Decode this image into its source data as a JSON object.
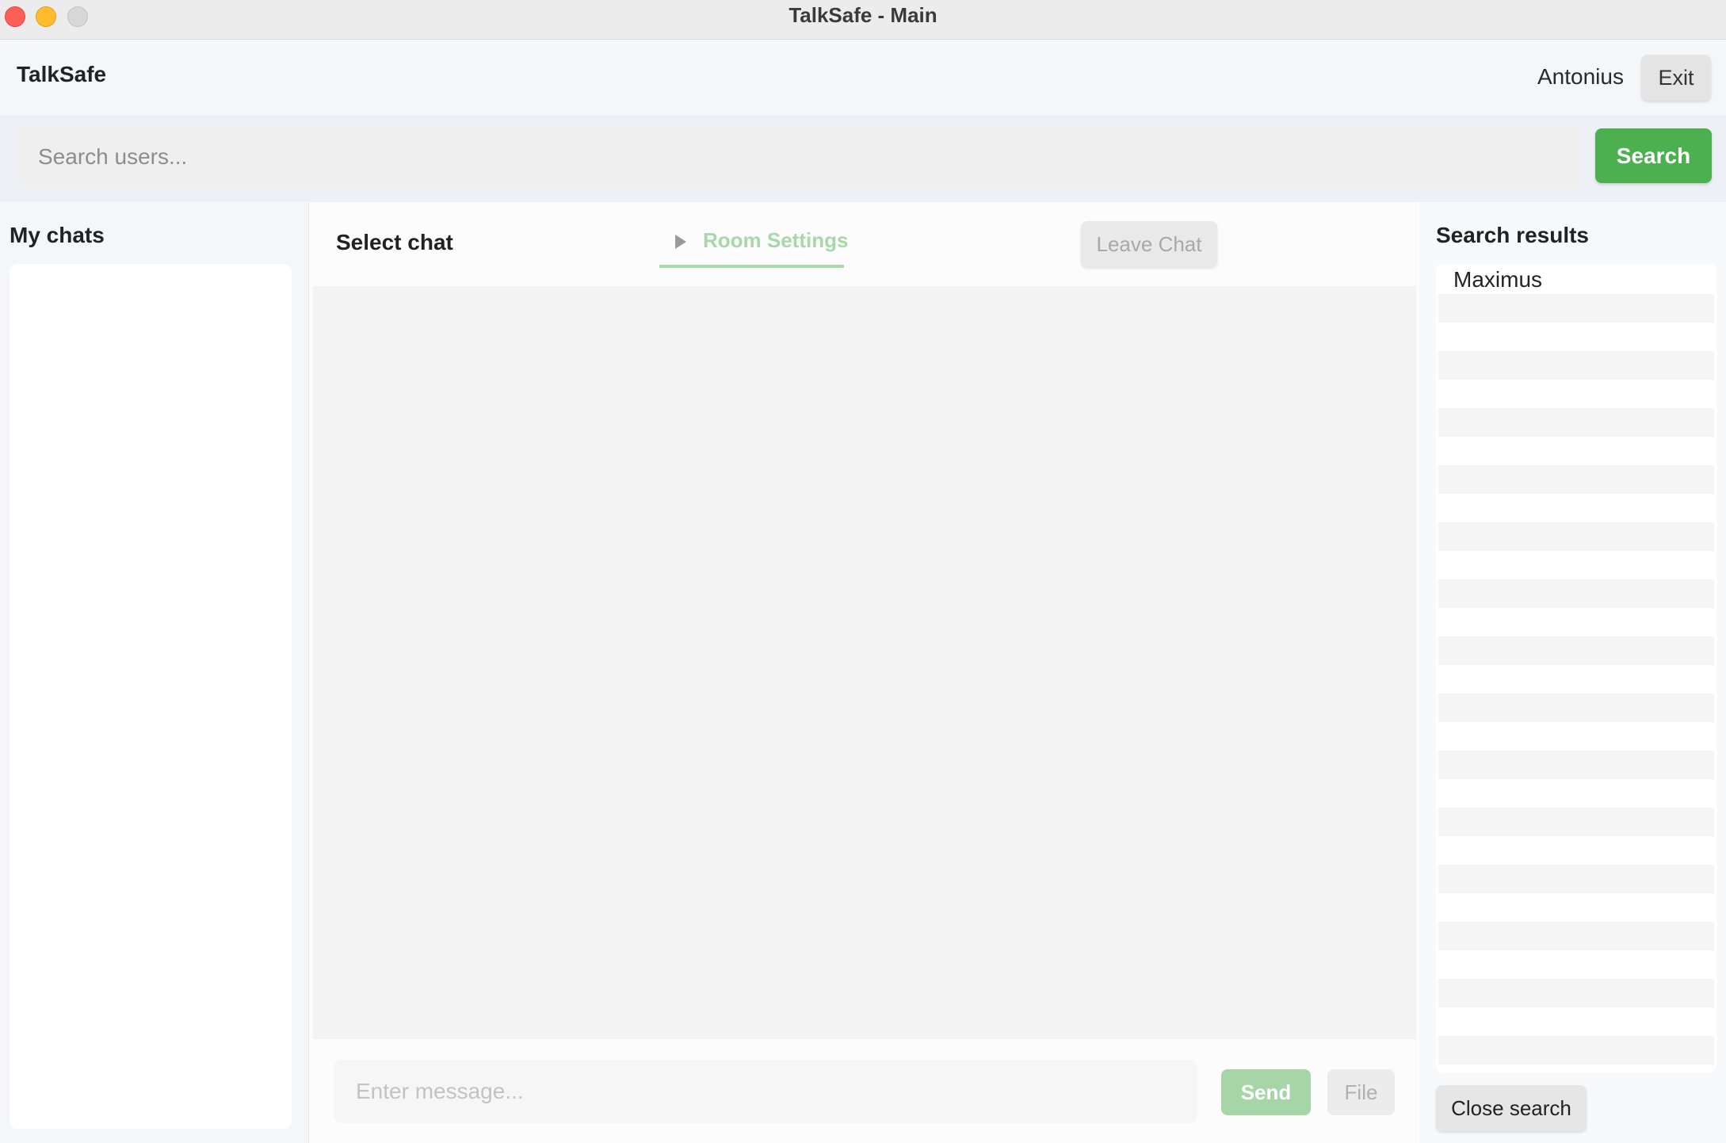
{
  "window": {
    "title": "TalkSafe - Main"
  },
  "header": {
    "brand": "TalkSafe",
    "username": "Antonius",
    "exit_label": "Exit"
  },
  "search": {
    "placeholder": "Search users...",
    "button_label": "Search"
  },
  "left_panel": {
    "title": "My chats",
    "chats": []
  },
  "chat": {
    "title": "Select chat",
    "room_settings_label": "Room Settings",
    "leave_label": "Leave Chat",
    "message_placeholder": "Enter message...",
    "send_label": "Send",
    "file_label": "File"
  },
  "results": {
    "title": "Search results",
    "items": [
      "Maximus"
    ],
    "close_label": "Close search"
  },
  "colors": {
    "accent": "#4caf50",
    "accent_disabled": "#a6d6a7",
    "close": "#fe5f57",
    "minimize": "#febc2e",
    "maximize": "#d7d7d7"
  },
  "icons": [
    "close-window-icon",
    "minimize-window-icon",
    "zoom-window-icon",
    "disclosure-triangle-icon"
  ]
}
